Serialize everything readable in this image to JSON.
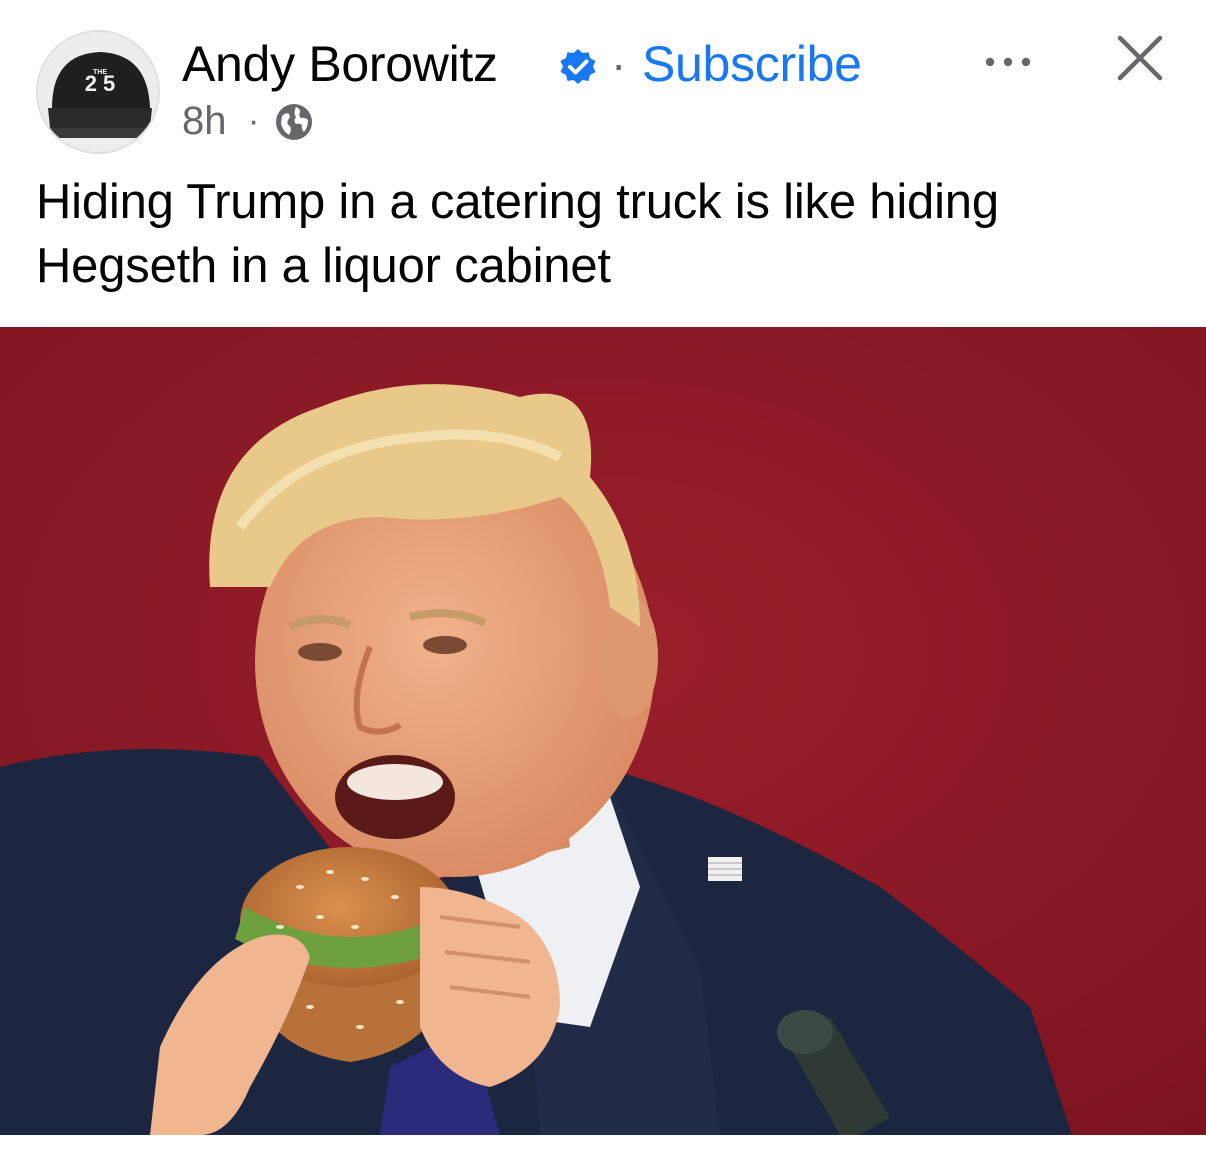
{
  "author": {
    "name": "Andy Borowitz",
    "verified": true,
    "subscribe_label": "Subscribe",
    "separator": "·",
    "avatar_text": "2 5",
    "avatar_cap_letters": "THE"
  },
  "meta": {
    "time": "8h",
    "separator": "·",
    "audience_icon": "globe-icon"
  },
  "actions": {
    "more_icon": "more-horizontal-icon",
    "more_label": "•••",
    "close_icon": "close-icon"
  },
  "post": {
    "text": "Hiding Trump in a catering truck is like hiding Hegseth in a liquor cabinet"
  },
  "colors": {
    "link": "#1877f2",
    "verified_badge": "#1877f2",
    "secondary_text": "#65676b",
    "photo_background": "#8c1a24"
  }
}
